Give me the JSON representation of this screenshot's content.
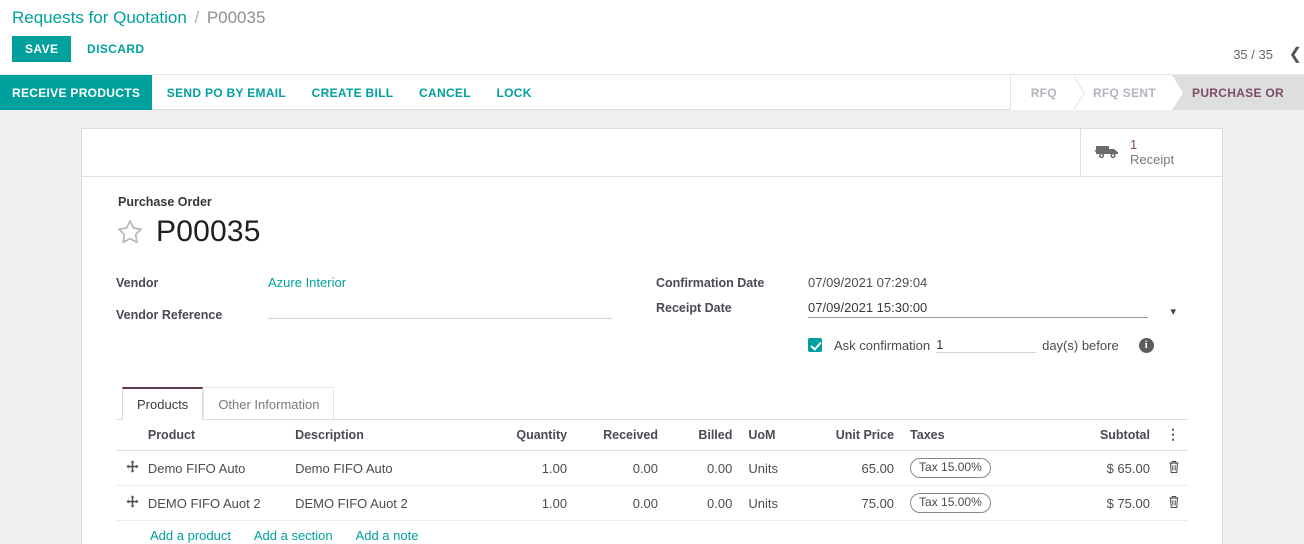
{
  "breadcrumb": {
    "parent": "Requests for Quotation",
    "separator": "/",
    "current": "P00035"
  },
  "control_panel": {
    "save_label": "SAVE",
    "discard_label": "DISCARD",
    "pager_count": "35 / 35",
    "pager_prev": "❮"
  },
  "action_bar": {
    "buttons": [
      {
        "label": "RECEIVE PRODUCTS",
        "primary": true
      },
      {
        "label": "SEND PO BY EMAIL",
        "primary": false
      },
      {
        "label": "CREATE BILL",
        "primary": false
      },
      {
        "label": "CANCEL",
        "primary": false
      },
      {
        "label": "LOCK",
        "primary": false
      }
    ],
    "statuses": [
      {
        "label": "RFQ",
        "active": false
      },
      {
        "label": "RFQ SENT",
        "active": false
      },
      {
        "label": "PURCHASE OR",
        "active": true
      }
    ]
  },
  "smart_buttons": [
    {
      "icon": "truck-icon",
      "count": "1",
      "label": "Receipt"
    }
  ],
  "form": {
    "subtitle": "Purchase Order",
    "title": "P00035",
    "left_fields": [
      {
        "label": "Vendor",
        "value": "Azure Interior",
        "type": "link"
      },
      {
        "label": "Vendor Reference",
        "value": "",
        "type": "input"
      }
    ],
    "right_fields": [
      {
        "label": "Confirmation Date",
        "value": "07/09/2021 07:29:04",
        "type": "text"
      },
      {
        "label": "Receipt Date",
        "value": "07/09/2021 15:30:00",
        "type": "date"
      }
    ],
    "ask_confirmation": {
      "checked": true,
      "label": "Ask confirmation",
      "days": "1",
      "suffix": "day(s) before",
      "info": "i"
    }
  },
  "notebook": {
    "tabs": [
      {
        "label": "Products",
        "active": true
      },
      {
        "label": "Other Information",
        "active": false
      }
    ]
  },
  "lines_table": {
    "columns": [
      "Product",
      "Description",
      "Quantity",
      "Received",
      "Billed",
      "UoM",
      "Unit Price",
      "Taxes",
      "Subtotal"
    ],
    "options_icon": "vertical-dots-icon",
    "rows": [
      {
        "handle": "drag-handle-icon",
        "product": "Demo FIFO Auto",
        "description": "Demo FIFO Auto",
        "quantity": "1.00",
        "received": "0.00",
        "billed": "0.00",
        "uom": "Units",
        "unit_price": "65.00",
        "taxes": "Tax 15.00%",
        "subtotal": "$ 65.00",
        "delete_icon": "trash-icon"
      },
      {
        "handle": "drag-handle-icon",
        "product": "DEMO FIFO Auot 2",
        "description": "DEMO FIFO Auot 2",
        "quantity": "1.00",
        "received": "0.00",
        "billed": "0.00",
        "uom": "Units",
        "unit_price": "75.00",
        "taxes": "Tax 15.00%",
        "subtotal": "$ 75.00",
        "delete_icon": "trash-icon"
      }
    ],
    "add_links": [
      "Add a product",
      "Add a section",
      "Add a note"
    ]
  },
  "colors": {
    "accent": "#00a09d",
    "status_active_text": "#7c4d67",
    "page_bg": "#f0f0f0"
  }
}
